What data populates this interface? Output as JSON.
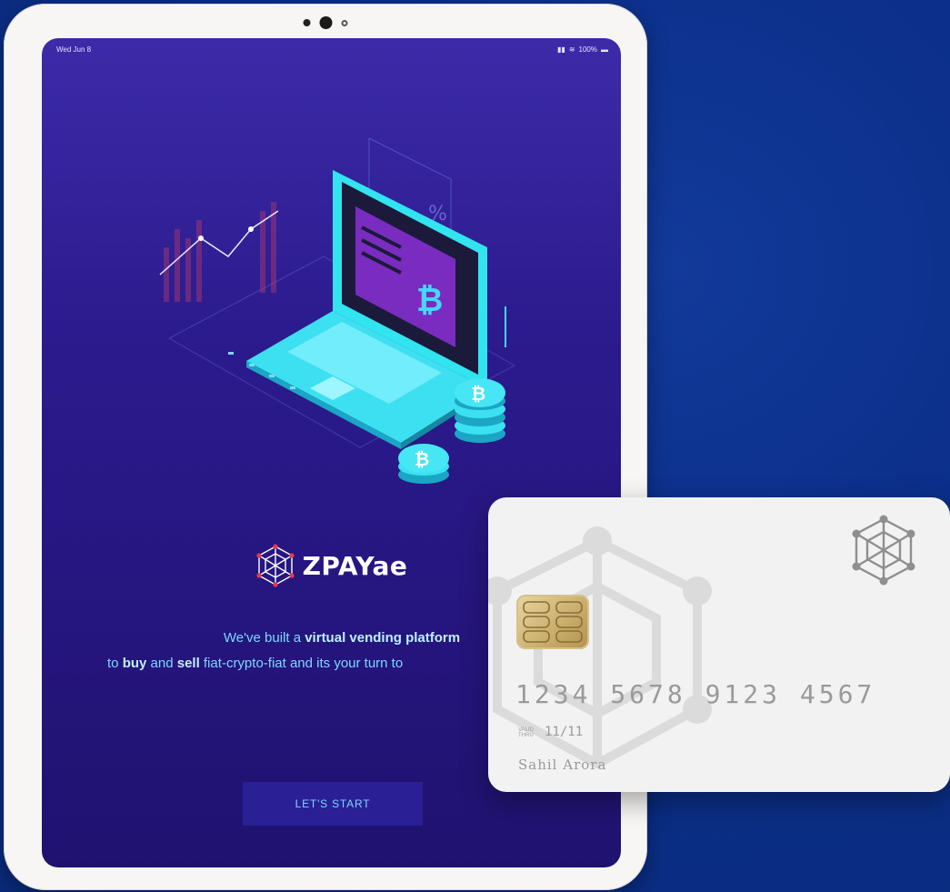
{
  "status_bar": {
    "date": "Wed Jun 8",
    "battery": "100%"
  },
  "brand": {
    "name": "ZPAYae"
  },
  "tagline": {
    "line1_pre": "We've built a ",
    "line1_bold": "virtual vending platform",
    "line2_pre": "to ",
    "line2_bold1": "buy",
    "line2_mid": " and ",
    "line2_bold2": "sell",
    "line2_post": " fiat-crypto-fiat and its your turn to"
  },
  "cta": {
    "label": "LET'S START"
  },
  "card": {
    "number": "1234 5678 9123 4567",
    "expiry_label": "VALID THRU",
    "expiry": "11/11",
    "holder": "Sahil Arora"
  },
  "icons": {
    "bitcoin": "bitcoin-icon",
    "logo": "web-polyhedron-icon"
  },
  "colors": {
    "screen_bg": "#2c1b8e",
    "accent": "#7fd6ff",
    "laptop": "#3de0f0",
    "page_bg": "#0b2f8a"
  }
}
